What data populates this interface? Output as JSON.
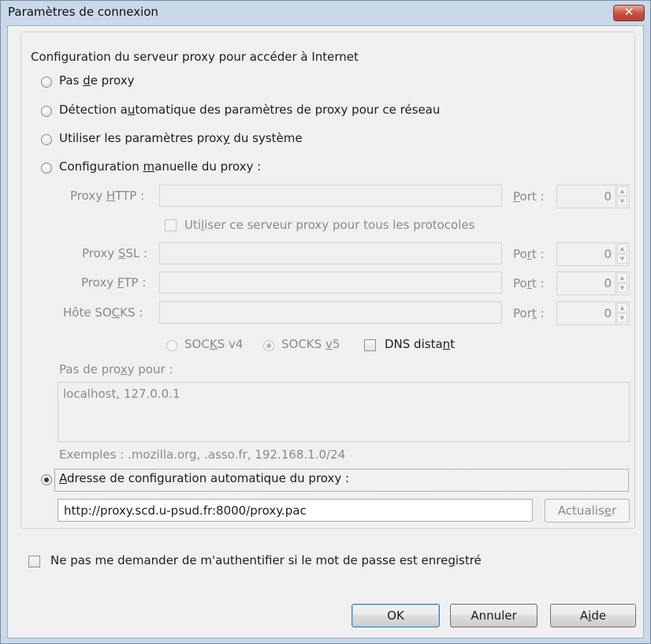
{
  "window": {
    "title": "Paramètres de connexion",
    "close_glyph": "✕"
  },
  "proxy_group": {
    "legend": "Configuration du serveur proxy pour accéder à Internet",
    "options": {
      "no_proxy": {
        "pre": "Pas ",
        "key": "d",
        "post": "e proxy",
        "selected": false
      },
      "auto_detect": {
        "pre": "Détection a",
        "key": "u",
        "post": "tomatique des paramètres de proxy pour ce réseau",
        "selected": false
      },
      "system": {
        "pre": "Utiliser les paramètres prox",
        "key": "y",
        "post": " du système",
        "selected": false
      },
      "manual": {
        "pre": "Configuration ",
        "key": "m",
        "post": "anuelle du proxy :",
        "selected": false
      },
      "auto_url": {
        "pre": "",
        "key": "A",
        "post": "dresse de configuration automatique du proxy :",
        "selected": true
      }
    },
    "manual": {
      "http": {
        "pre": "Proxy ",
        "key": "H",
        "post": "TTP :",
        "value": ""
      },
      "port_http": {
        "pre": "",
        "key": "P",
        "post": "ort :",
        "value": "0"
      },
      "same_proxy": {
        "pre": "Uti",
        "key": "l",
        "post": "iser ce serveur proxy pour tous les protocoles",
        "checked": false
      },
      "ssl": {
        "pre": "Proxy ",
        "key": "S",
        "post": "SL :",
        "value": ""
      },
      "port_ssl": {
        "pre": "Po",
        "key": "r",
        "post": "t :",
        "value": "0"
      },
      "ftp": {
        "pre": "Proxy ",
        "key": "F",
        "post": "TP :",
        "value": ""
      },
      "port_ftp": {
        "pre": "Po",
        "key": "r",
        "post": "t :",
        "value": "0"
      },
      "socks": {
        "pre": "Hôte SO",
        "key": "C",
        "post": "KS :",
        "value": ""
      },
      "port_socks": {
        "pre": "Por",
        "key": "t",
        "post": " :",
        "value": "0"
      },
      "socks_v4": {
        "pre": "SOC",
        "key": "K",
        "post": "S v4",
        "selected": false
      },
      "socks_v5": {
        "pre": "SOCKS ",
        "key": "v",
        "post": "5",
        "selected": true
      },
      "dns": {
        "pre": "DNS dista",
        "key": "n",
        "post": "t",
        "checked": false
      }
    },
    "no_proxy_for": {
      "label_pre": "Pas de pro",
      "label_key": "x",
      "label_post": "y pour :",
      "value": "localhost, 127.0.0.1",
      "examples": "Exemples : .mozilla.org, .asso.fr, 192.168.1.0/24"
    },
    "auto_url_value": "http://proxy.scd.u-psud.fr:8000/proxy.pac",
    "reload_button": {
      "pre": "Actualis",
      "key": "e",
      "post": "r"
    }
  },
  "auth_checkbox": {
    "pre": "Ne pas me demander de m'authentifier si le mot de passe est enre",
    "key": "g",
    "post": "istré",
    "checked": false
  },
  "buttons": {
    "ok": "OK",
    "cancel": "Annuler",
    "help": {
      "pre": "A",
      "key": "i",
      "post": "de"
    }
  },
  "spin_glyphs": {
    "up": "▲",
    "down": "▼"
  }
}
